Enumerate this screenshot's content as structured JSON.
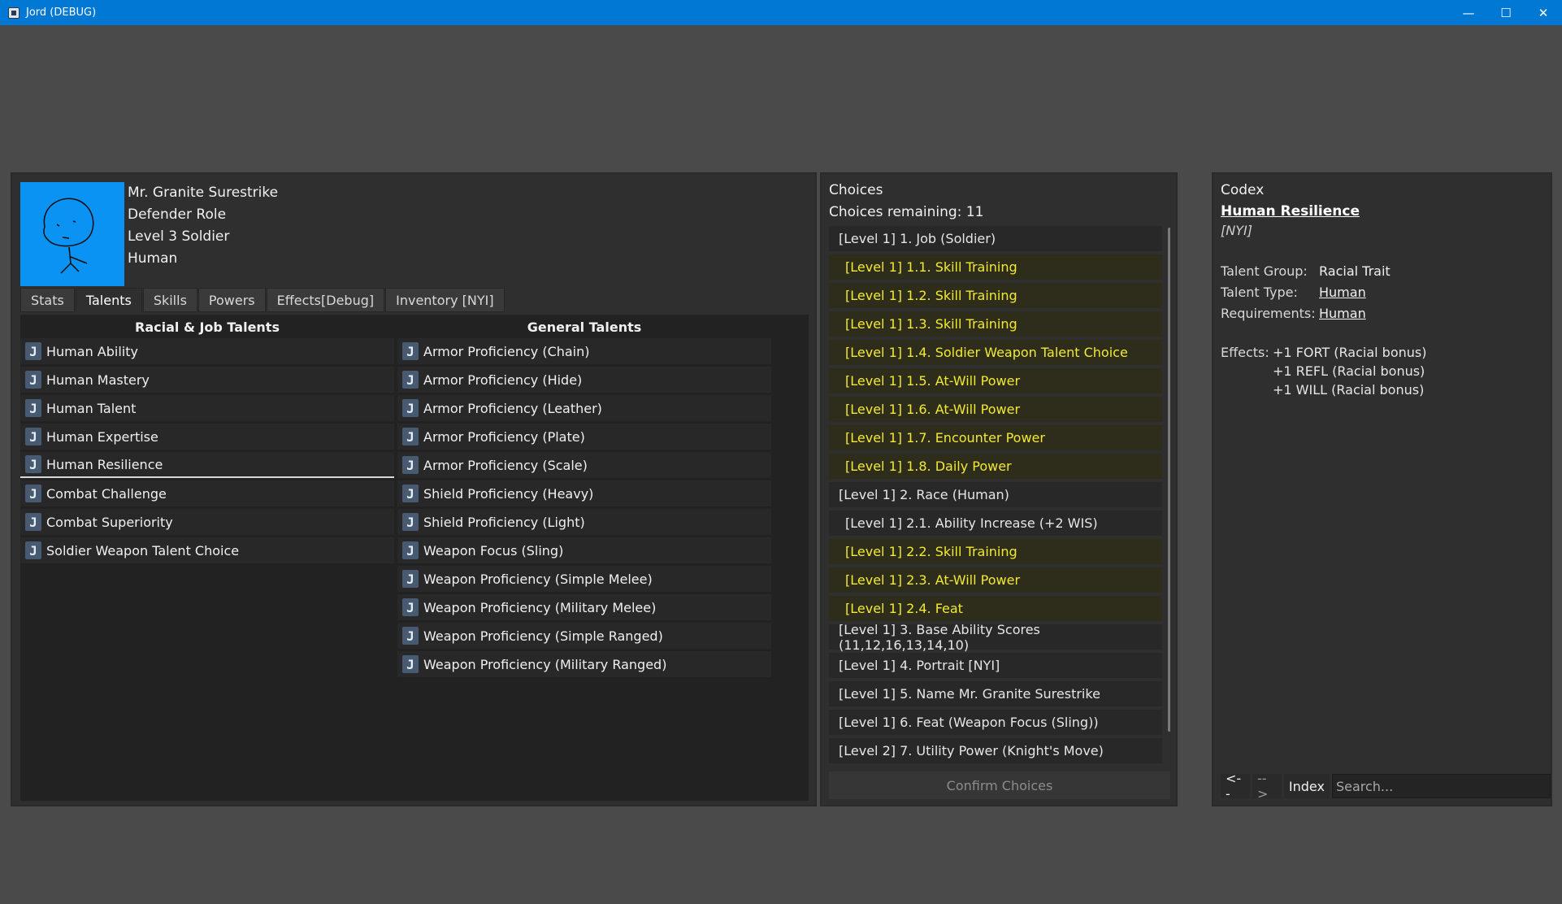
{
  "window": {
    "title": "Jord (DEBUG)",
    "minimize": "—",
    "maximize": "☐",
    "close": "✕"
  },
  "character": {
    "name": "Mr. Granite Surestrike",
    "role": "Defender Role",
    "level": "Level 3 Soldier",
    "race": "Human"
  },
  "tabs": [
    "Stats",
    "Talents",
    "Skills",
    "Powers",
    "Effects[Debug]",
    "Inventory [NYI]"
  ],
  "talents": {
    "racial_header": "Racial & Job Talents",
    "general_header": "General Talents",
    "icon_glyph": "J",
    "racial": [
      "Human Ability",
      "Human Mastery",
      "Human Talent",
      "Human Expertise",
      "Human Resilience",
      "Combat Challenge",
      "Combat Superiority",
      "Soldier Weapon Talent Choice"
    ],
    "general": [
      "Armor Proficiency (Chain)",
      "Armor Proficiency (Hide)",
      "Armor Proficiency (Leather)",
      "Armor Proficiency (Plate)",
      "Armor Proficiency (Scale)",
      "Shield Proficiency (Heavy)",
      "Shield Proficiency (Light)",
      "Weapon Focus (Sling)",
      "Weapon Proficiency (Simple Melee)",
      "Weapon Proficiency (Military Melee)",
      "Weapon Proficiency (Simple Ranged)",
      "Weapon Proficiency (Military Ranged)"
    ]
  },
  "choices": {
    "title": "Choices",
    "remaining": "Choices remaining: 11",
    "confirm": "Confirm Choices",
    "items": [
      "[Level 1] 1. Job (Soldier)",
      "[Level 1] 1.1. Skill Training",
      "[Level 1] 1.2. Skill Training",
      "[Level 1] 1.3. Skill Training",
      "[Level 1] 1.4. Soldier Weapon Talent Choice",
      "[Level 1] 1.5. At-Will Power",
      "[Level 1] 1.6. At-Will Power",
      "[Level 1] 1.7. Encounter Power",
      "[Level 1] 1.8. Daily Power",
      "[Level 1] 2. Race (Human)",
      "[Level 1] 2.1. Ability Increase (+2 WIS)",
      "[Level 1] 2.2. Skill Training",
      "[Level 1] 2.3. At-Will Power",
      "[Level 1] 2.4. Feat",
      "[Level 1] 3. Base Ability Scores (11,12,16,13,14,10)",
      "[Level 1] 4. Portrait [NYI]",
      "[Level 1] 5. Name Mr. Granite Surestrike",
      "[Level 1] 6. Feat (Weapon Focus (Sling))",
      "[Level 2] 7. Utility Power (Knight's Move)"
    ]
  },
  "codex": {
    "title": "Codex",
    "entry_title": "Human Resilience",
    "nyi": "[NYI]",
    "group_label": "Talent Group:",
    "group_value": "Racial Trait",
    "type_label": "Talent Type:",
    "type_value": "Human",
    "req_label": "Requirements:",
    "req_value": "Human",
    "effects_label": "Effects:",
    "effects": [
      "+1 FORT (Racial bonus)",
      "+1 REFL (Racial bonus)",
      "+1 WILL (Racial bonus)"
    ],
    "back": "<--",
    "forward": "-->",
    "index": "Index",
    "search_placeholder": "Search..."
  }
}
